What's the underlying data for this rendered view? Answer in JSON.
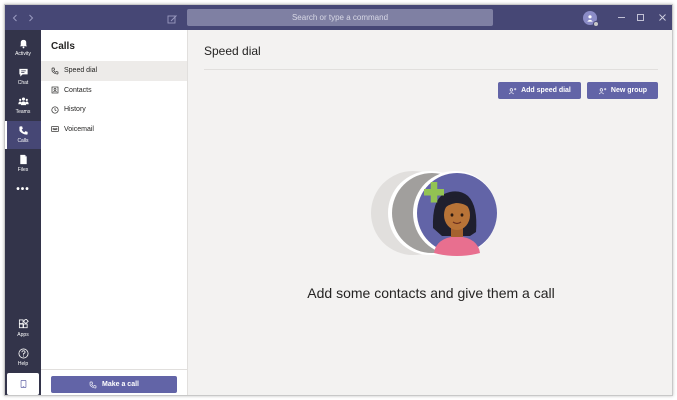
{
  "titlebar": {
    "search_placeholder": "Search or type a command",
    "icons": [
      "back-icon",
      "forward-icon",
      "compose-icon",
      "minimize-icon",
      "maximize-icon",
      "close-icon"
    ]
  },
  "appbar": {
    "items": [
      {
        "label": "Activity",
        "icon": "bell-icon"
      },
      {
        "label": "Chat",
        "icon": "chat-icon"
      },
      {
        "label": "Teams",
        "icon": "teams-icon"
      },
      {
        "label": "Calls",
        "icon": "phone-icon",
        "active": true
      },
      {
        "label": "Files",
        "icon": "file-icon"
      }
    ],
    "bottom_items": [
      {
        "label": "Apps",
        "icon": "apps-icon"
      },
      {
        "label": "Help",
        "icon": "help-icon"
      }
    ]
  },
  "leftpanel": {
    "title": "Calls",
    "items": [
      {
        "label": "Speed dial",
        "icon": "phone-icon",
        "active": true
      },
      {
        "label": "Contacts",
        "icon": "contact-card-icon"
      },
      {
        "label": "History",
        "icon": "clock-icon"
      },
      {
        "label": "Voicemail",
        "icon": "voicemail-icon"
      }
    ],
    "make_call_label": "Make a call"
  },
  "main": {
    "title": "Speed dial",
    "add_speed_dial_label": "Add speed dial",
    "new_group_label": "New group",
    "empty_message": "Add some contacts and give them a call"
  },
  "colors": {
    "titlebar": "#464775",
    "appbar": "#33344a",
    "accent": "#6264a7",
    "background": "#f3f2f1"
  }
}
